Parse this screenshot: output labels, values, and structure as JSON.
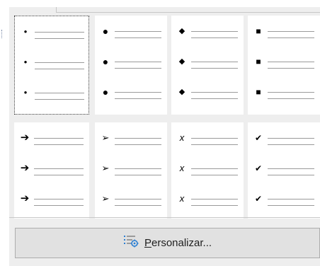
{
  "tiles": [
    {
      "name": "bullet-style-small-dot",
      "glyph": "•",
      "size": 13,
      "row": 0,
      "col": 0,
      "selected": true
    },
    {
      "name": "bullet-style-large-dot",
      "glyph": "●",
      "size": 14,
      "row": 0,
      "col": 1,
      "selected": false
    },
    {
      "name": "bullet-style-diamond",
      "glyph": "◆",
      "size": 11,
      "row": 0,
      "col": 2,
      "selected": false
    },
    {
      "name": "bullet-style-square",
      "glyph": "■",
      "size": 12,
      "row": 0,
      "col": 3,
      "selected": false
    },
    {
      "name": "bullet-style-bold-arrow",
      "glyph": "➔",
      "size": 15,
      "row": 1,
      "col": 0,
      "selected": false
    },
    {
      "name": "bullet-style-arrowhead",
      "glyph": "➢",
      "size": 13,
      "row": 1,
      "col": 1,
      "selected": false
    },
    {
      "name": "bullet-style-x",
      "glyph": "x",
      "size": 13,
      "row": 1,
      "col": 2,
      "selected": false
    },
    {
      "name": "bullet-style-check",
      "glyph": "✔",
      "size": 12,
      "row": 1,
      "col": 3,
      "selected": false
    }
  ],
  "button": {
    "label_prefix": "",
    "label_underlined": "P",
    "label_rest": "ersonalizar...",
    "icon": "customize-list-icon"
  },
  "colors": {
    "panel_bg": "#eeeeee",
    "tile_bg": "#ffffff",
    "line": "#9a9a9a",
    "button_bg": "#e1e1e1",
    "icon_accent": "#2a7ed2"
  }
}
